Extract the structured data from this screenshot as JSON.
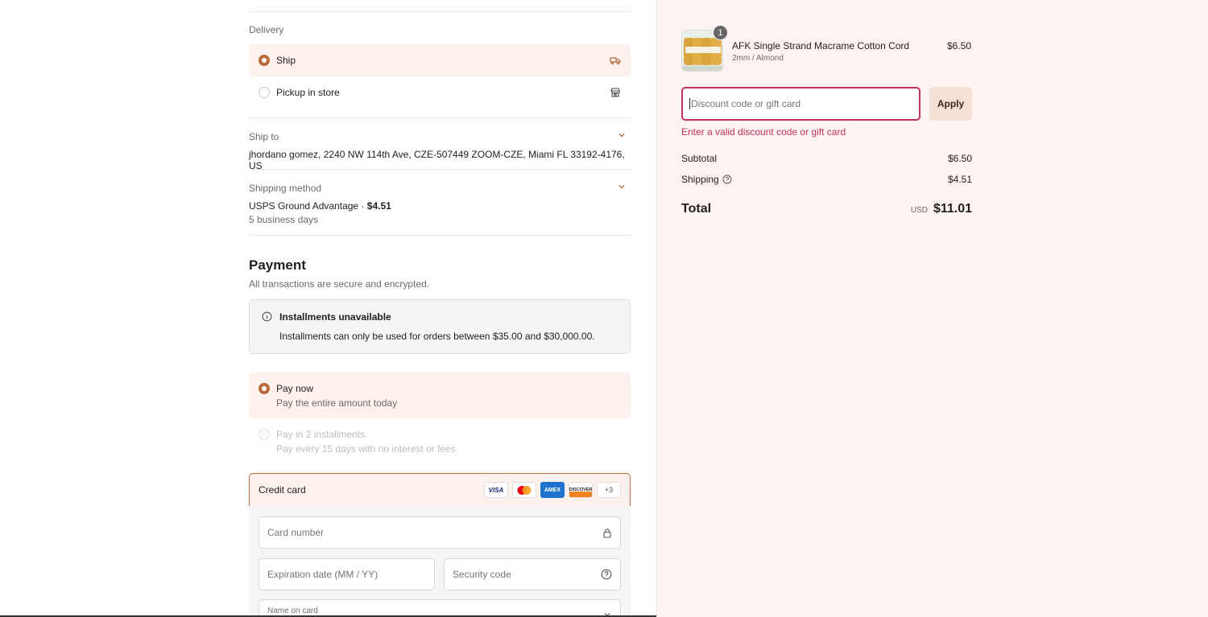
{
  "delivery": {
    "label": "Delivery",
    "options": [
      {
        "label": "Ship",
        "selected": true,
        "icon": "truck-icon"
      },
      {
        "label": "Pickup in store",
        "selected": false,
        "icon": "store-icon"
      }
    ]
  },
  "ship_to": {
    "label": "Ship to",
    "address": "jhordano gomez, 2240 NW 114th Ave, CZE-507449 ZOOM-CZE, Miami FL 33192-4176, US"
  },
  "shipping_method": {
    "label": "Shipping method",
    "name": "USPS Ground Advantage · ",
    "price": "$4.51",
    "eta": "5 business days"
  },
  "payment": {
    "title": "Payment",
    "subtitle": "All transactions are secure and encrypted.",
    "notice_title": "Installments unavailable",
    "notice_body": "Installments can only be used for orders between $35.00 and $30,000.00.",
    "options": [
      {
        "title": "Pay now",
        "desc": "Pay the entire amount today",
        "selected": true,
        "disabled": false
      },
      {
        "title": "Pay in 2 installments",
        "desc": "Pay every 15 days with no interest or fees",
        "selected": false,
        "disabled": true
      }
    ],
    "credit_card_label": "Credit card",
    "brands": [
      "VISA",
      "",
      "AMEX",
      "DISCOVER"
    ],
    "more_brands": "+3",
    "card_number_placeholder": "Card number",
    "expiration_placeholder": "Expiration date (MM / YY)",
    "security_placeholder": "Security code",
    "name_on_card_label": "Name on card"
  },
  "summary": {
    "item": {
      "name": "AFK Single Strand Macrame Cotton Cord",
      "variant": "2mm / Almond",
      "price": "$6.50",
      "quantity": "1"
    },
    "discount_placeholder": "Discount code or gift card",
    "apply_label": "Apply",
    "error": "Enter a valid discount code or gift card",
    "subtotal_label": "Subtotal",
    "subtotal": "$6.50",
    "shipping_label": "Shipping",
    "shipping": "$4.51",
    "total_label": "Total",
    "currency": "USD",
    "total": "$11.01"
  },
  "colors": {
    "accent": "#b86a3e",
    "error": "#c0315b",
    "sidebar_bg": "#fdf4f1"
  }
}
